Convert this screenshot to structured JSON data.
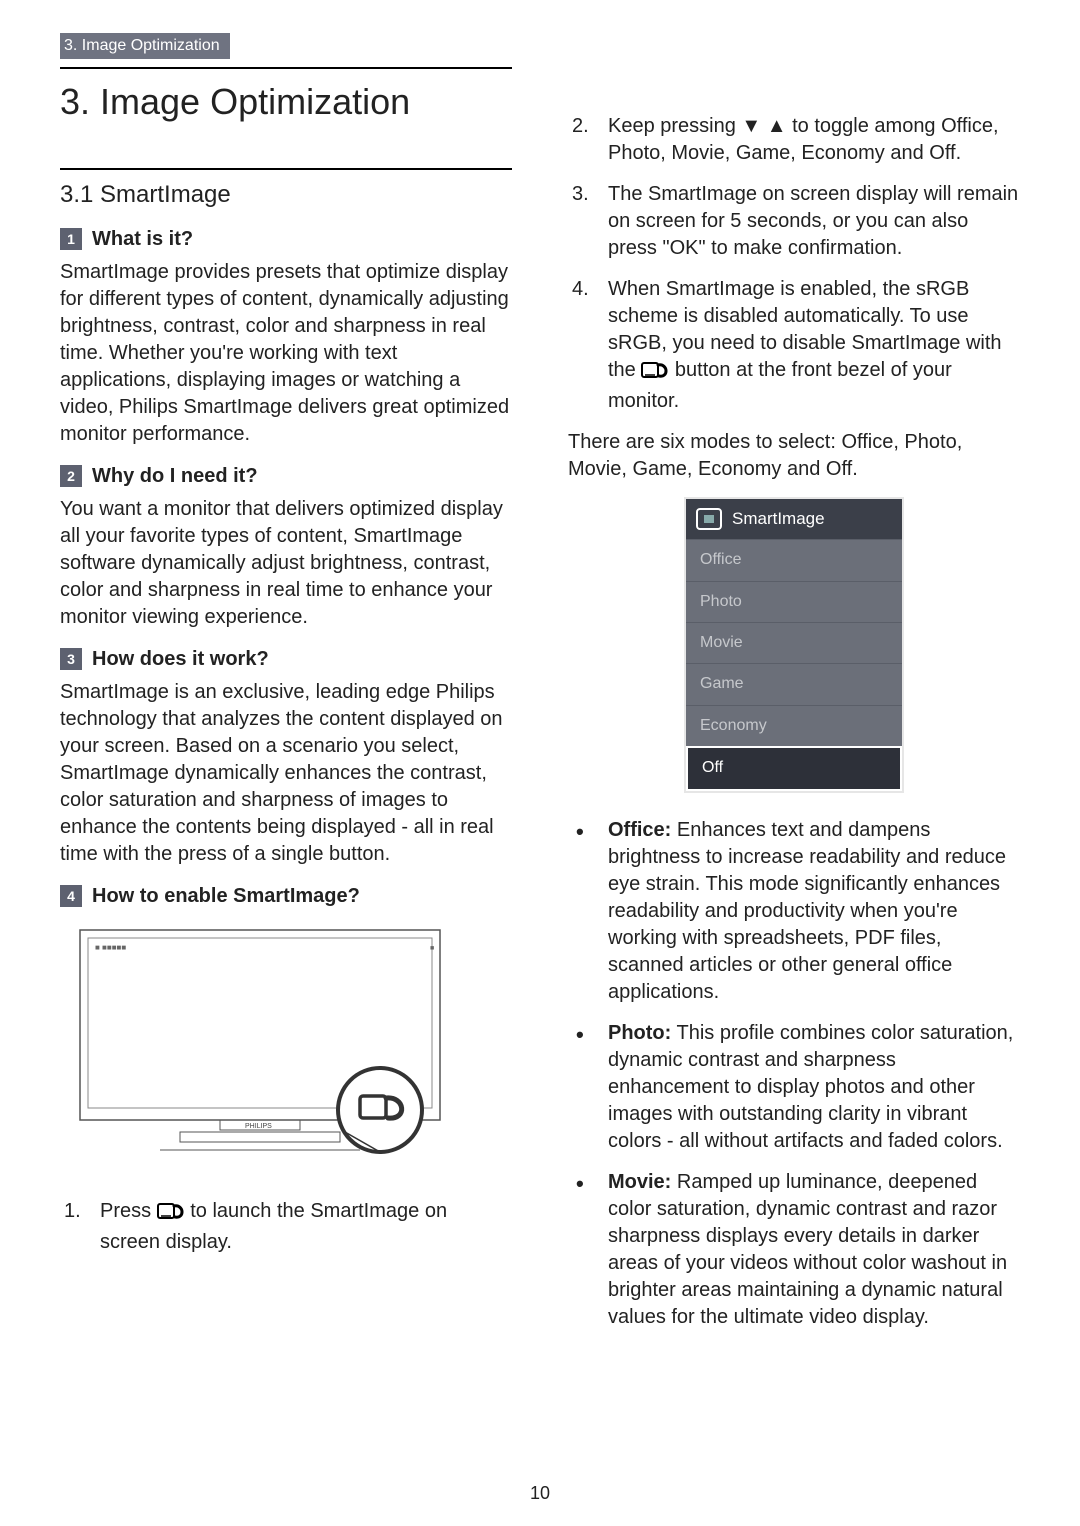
{
  "header_tab": "3. Image Optimization",
  "chapter_title": "3.  Image Optimization",
  "section_title": "3.1  SmartImage",
  "left": {
    "q1": {
      "num": "1",
      "label": "What is it?",
      "body": "SmartImage provides presets that optimize display for different types of content, dynamically adjusting brightness, contrast, color and sharpness in real time. Whether you're working with text applications, displaying images or watching a video, Philips SmartImage delivers great optimized monitor performance."
    },
    "q2": {
      "num": "2",
      "label": "Why do I need it?",
      "body": "You want a monitor that delivers optimized display all your favorite types of content, SmartImage software dynamically adjust brightness, contrast, color and sharpness in real time to enhance your monitor viewing experience."
    },
    "q3": {
      "num": "3",
      "label": "How does it work?",
      "body": "SmartImage is an exclusive, leading edge Philips technology that analyzes the content displayed on your screen. Based on a scenario you select, SmartImage dynamically enhances the contrast, color saturation and sharpness of images to enhance the contents being displayed - all in real time with the press of a single button."
    },
    "q4": {
      "num": "4",
      "label": "How to enable SmartImage?"
    },
    "step1_a": "Press ",
    "step1_b": " to launch the SmartImage on screen display."
  },
  "right": {
    "step2": "Keep pressing ▼ ▲ to toggle among Office, Photo, Movie, Game, Economy and Off.",
    "step3": "The SmartImage on screen display will remain on screen for 5 seconds, or you can also press \"OK\" to make confirmation.",
    "step4_a": "When SmartImage is enabled, the sRGB scheme is disabled automatically. To use sRGB, you need to disable SmartImage with the ",
    "step4_b": " button at the front bezel of your monitor.",
    "modes_intro": "There are six modes to select: Office, Photo, Movie, Game, Economy and Off.",
    "osd": {
      "title": "SmartImage",
      "items": [
        "Office",
        "Photo",
        "Movie",
        "Game",
        "Economy",
        "Off"
      ],
      "selected": "Off"
    },
    "bullets": {
      "office_label": "Office:",
      "office_body": " Enhances text and dampens brightness to increase readability and reduce eye strain. This mode significantly enhances readability and productivity when you're working with spreadsheets, PDF files, scanned articles or other general office applications.",
      "photo_label": "Photo:",
      "photo_body": " This profile combines color saturation, dynamic contrast and sharpness enhancement to display photos and other images with outstanding clarity in vibrant colors - all without artifacts and faded colors.",
      "movie_label": "Movie:",
      "movie_body": " Ramped up luminance, deepened color saturation, dynamic contrast and razor sharpness displays every details in darker areas of your videos without color washout in brighter areas maintaining a dynamic natural values for the ultimate video display."
    }
  },
  "monitor_brand": "PHILIPS",
  "page_number": "10"
}
